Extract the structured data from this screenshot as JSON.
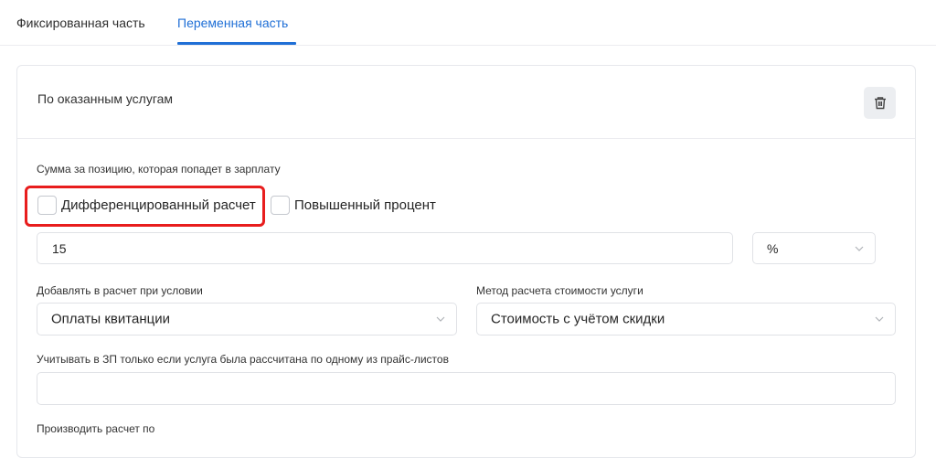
{
  "tabs": [
    {
      "label": "Фиксированная часть",
      "active": false
    },
    {
      "label": "Переменная часть",
      "active": true
    }
  ],
  "card": {
    "title": "По оказанным услугам",
    "delete_icon": "trash-icon",
    "sum_label": "Сумма за позицию, которая попадет в зарплату",
    "differentiated_label": "Дифференцированный расчет",
    "differentiated_checked": false,
    "increased_label": "Повышенный процент",
    "increased_checked": false,
    "amount_value": "15",
    "unit_value": "%",
    "condition_label": "Добавлять в расчет при условии",
    "condition_value": "Оплаты квитанции",
    "method_label": "Метод расчета стоимости услуги",
    "method_value": "Стоимость с учётом скидки",
    "pricelist_label": "Учитывать в ЗП только если услуга была рассчитана по одному из прайс-листов",
    "pricelist_value": "",
    "calc_by_label": "Производить расчет по"
  },
  "colors": {
    "accent": "#1f6fd6",
    "highlight": "#e81d1d"
  }
}
